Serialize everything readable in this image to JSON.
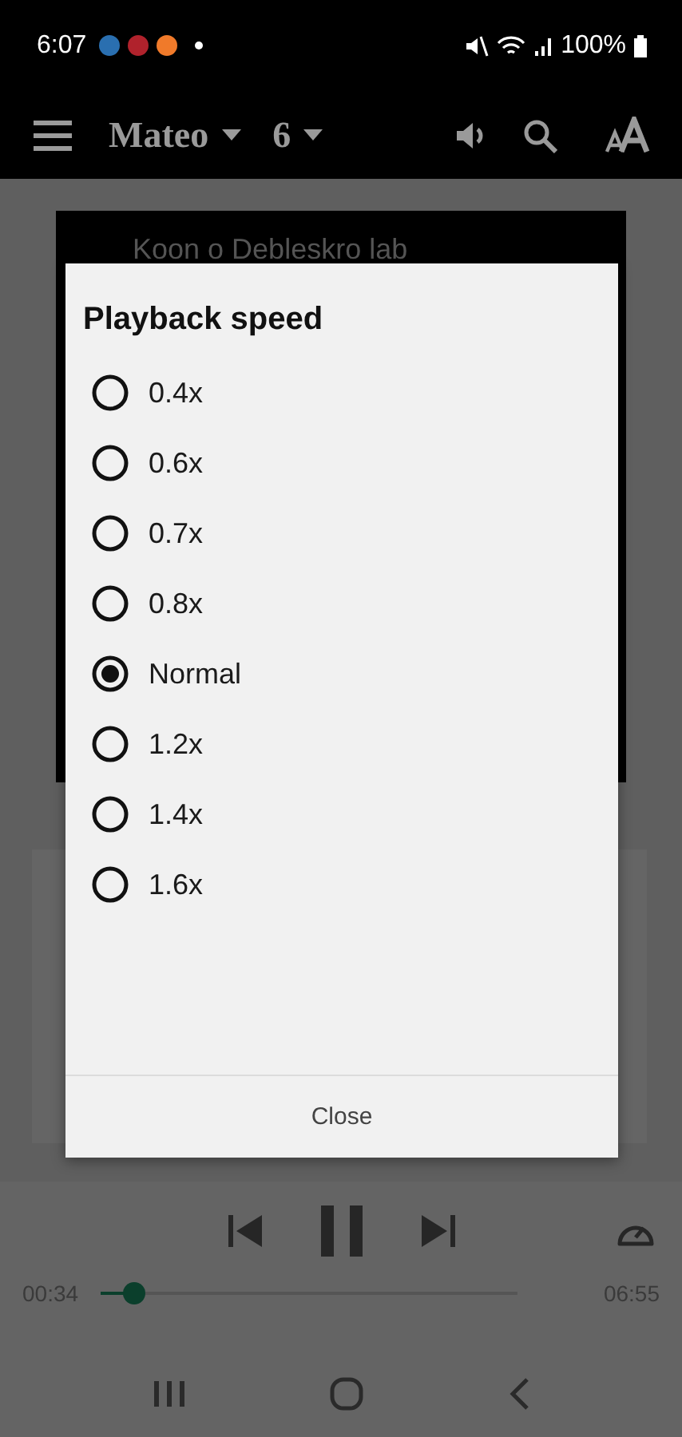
{
  "status_bar": {
    "time": "6:07",
    "battery": "100%"
  },
  "app_bar": {
    "title": "Mateo",
    "chapter": "6"
  },
  "content": {
    "heading": "Koon o Debleskro lab"
  },
  "dialog": {
    "title": "Playback speed",
    "options": [
      {
        "label": "0.4x",
        "selected": false
      },
      {
        "label": "0.6x",
        "selected": false
      },
      {
        "label": "0.7x",
        "selected": false
      },
      {
        "label": "0.8x",
        "selected": false
      },
      {
        "label": "Normal",
        "selected": true
      },
      {
        "label": "1.2x",
        "selected": false
      },
      {
        "label": "1.4x",
        "selected": false
      },
      {
        "label": "1.6x",
        "selected": false
      }
    ],
    "close": "Close"
  },
  "player": {
    "elapsed": "00:34",
    "duration": "06:55",
    "level": 0.08
  }
}
